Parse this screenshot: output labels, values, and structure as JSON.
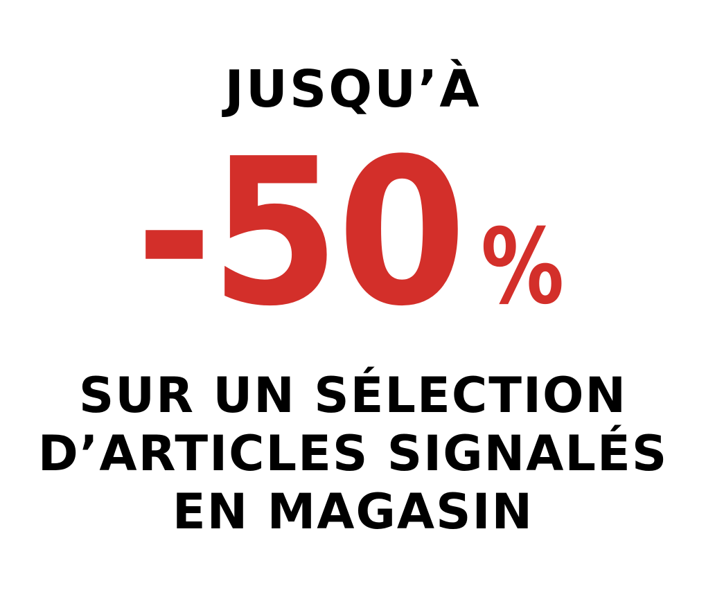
{
  "promo": {
    "headline_top": "JUSQU’À",
    "discount_value": "-50",
    "discount_unit": "%",
    "detail_lines": [
      "SUR UN SÉLECTION",
      "D’ARTICLES SIGNALÉS",
      "EN MAGASIN"
    ]
  },
  "colors": {
    "background": "#ffffff",
    "text": "#000000",
    "accent": "#d32f2a"
  }
}
